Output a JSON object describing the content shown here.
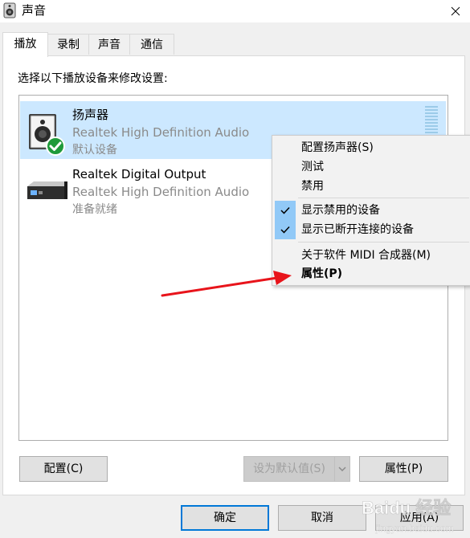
{
  "window": {
    "title": "声音",
    "icon": "speaker-icon",
    "close_icon": "close-icon"
  },
  "tabs": [
    {
      "label": "播放",
      "active": true
    },
    {
      "label": "录制",
      "active": false
    },
    {
      "label": "声音",
      "active": false
    },
    {
      "label": "通信",
      "active": false
    }
  ],
  "instruction": "选择以下播放设备来修改设置:",
  "devices": [
    {
      "name": "扬声器",
      "driver": "Realtek High Definition Audio",
      "status": "默认设备",
      "icon": "speaker-device-icon",
      "badge_icon": "default-check-icon",
      "selected": true
    },
    {
      "name": "Realtek Digital Output",
      "driver": "Realtek High Definition Audio",
      "status": "准备就绪",
      "icon": "digital-output-icon",
      "selected": false
    }
  ],
  "context_menu": {
    "items": [
      {
        "label": "配置扬声器(S)"
      },
      {
        "label": "测试"
      },
      {
        "label": "禁用"
      },
      {
        "label": "显示禁用的设备",
        "checked": true
      },
      {
        "label": "显示已断开连接的设备",
        "checked": true
      },
      {
        "label": "关于软件 MIDI 合成器(M)"
      },
      {
        "label": "属性(P)",
        "bold": true
      }
    ]
  },
  "buttons": {
    "configure": "配置(C)",
    "set_default": "设为默认值(S)",
    "properties": "属性(P)",
    "ok": "确定",
    "cancel": "取消",
    "apply": "应用(A)"
  },
  "watermark": {
    "brand": "Baidu 经验",
    "url": "jingyan.baidu.com"
  },
  "colors": {
    "selection": "#cce8ff",
    "accent": "#0078d7",
    "check_bg": "#91c9f7",
    "annotation_arrow": "#e8141b",
    "default_badge": "#1f9a3a"
  }
}
